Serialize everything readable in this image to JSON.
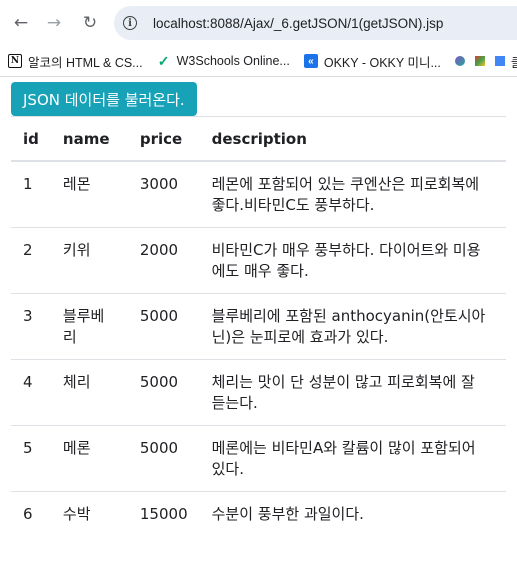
{
  "browser": {
    "url": "localhost:8088/Ajax/_6.getJSON/1(getJSON).jsp",
    "bookmarks": [
      {
        "icon": "notion-icon",
        "label": "알코의 HTML & CS..."
      },
      {
        "icon": "w3schools-icon",
        "label": "W3Schools Online..."
      },
      {
        "icon": "okky-icon",
        "label": "OKKY - OKKY 미니..."
      },
      {
        "icon": "extension-icon",
        "label": ""
      },
      {
        "icon": "extension-icon",
        "label": ""
      },
      {
        "icon": "bookmark-icon",
        "label": "클"
      }
    ]
  },
  "page": {
    "button_label": "JSON 데이터를 불러온다.",
    "table": {
      "headers": [
        "id",
        "name",
        "price",
        "description"
      ],
      "rows": [
        {
          "id": "1",
          "name": "레몬",
          "price": "3000",
          "description": "레몬에 포함되어 있는 쿠엔산은 피로회복에 좋다.비타민C도 풍부하다."
        },
        {
          "id": "2",
          "name": "키위",
          "price": "2000",
          "description": "비타민C가 매우 풍부하다. 다이어트와 미용에도 매우 좋다."
        },
        {
          "id": "3",
          "name": "블루베리",
          "price": "5000",
          "description": "블루베리에 포함된 anthocyanin(안토시아닌)은 눈피로에 효과가 있다."
        },
        {
          "id": "4",
          "name": "체리",
          "price": "5000",
          "description": "체리는 맛이 단 성분이 많고 피로회복에 잘 듣는다."
        },
        {
          "id": "5",
          "name": "메론",
          "price": "5000",
          "description": "메론에는 비타민A와 칼륨이 많이 포함되어 있다."
        },
        {
          "id": "6",
          "name": "수박",
          "price": "15000",
          "description": "수분이 풍부한 과일이다."
        }
      ]
    }
  },
  "colors": {
    "button_bg": "#17a2b8",
    "table_border": "#dee2e6"
  }
}
